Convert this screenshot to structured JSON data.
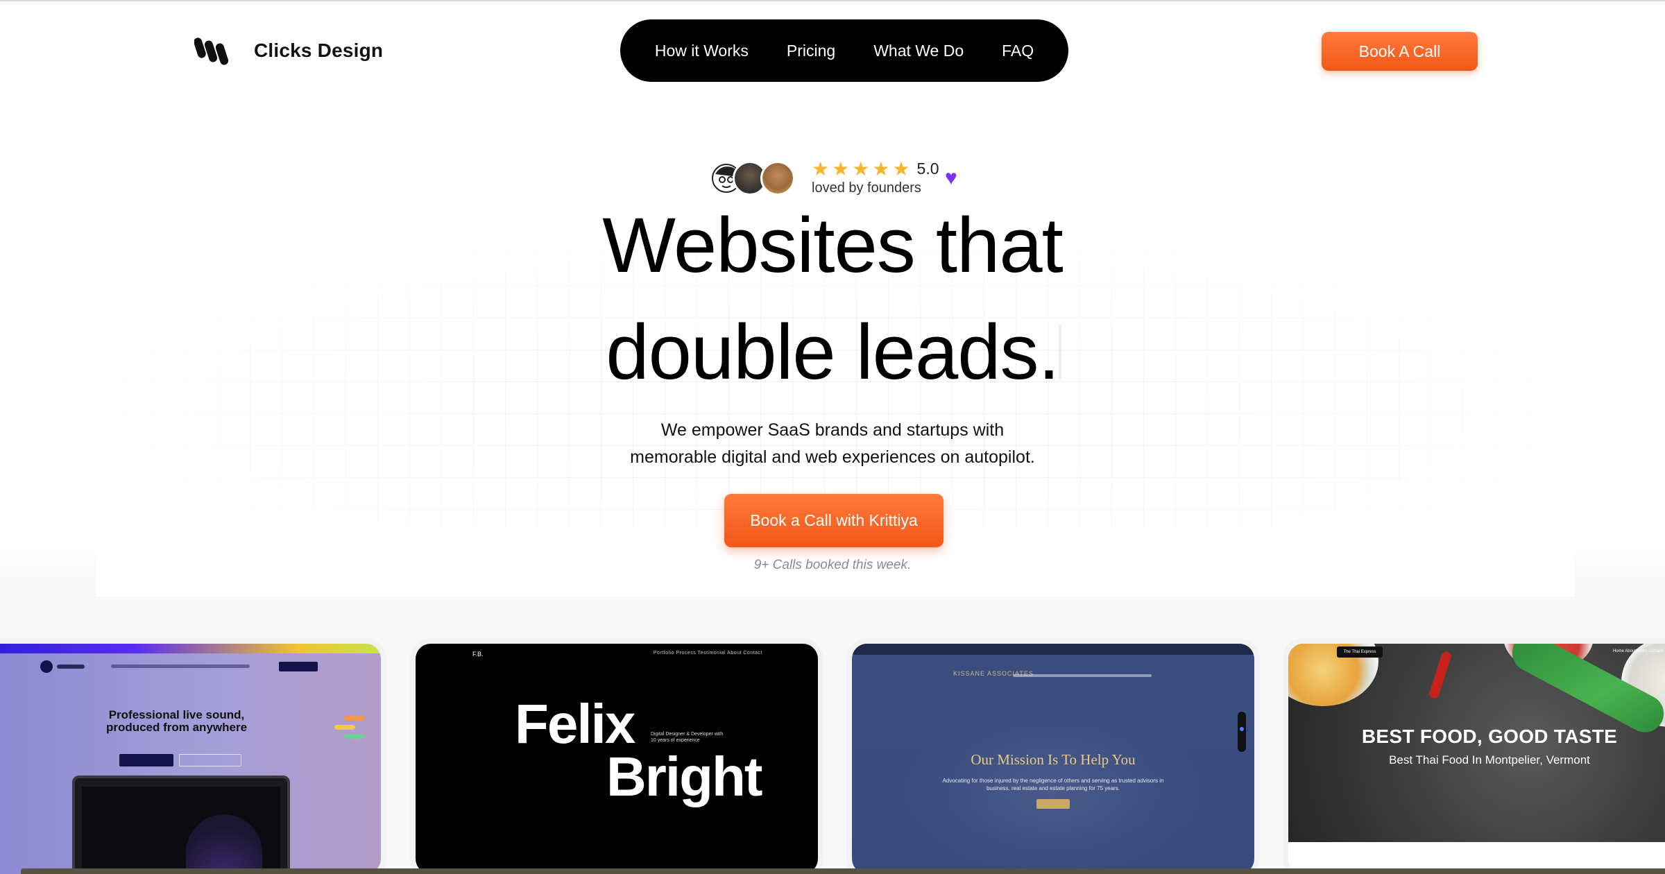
{
  "header": {
    "logo_text": "Clicks Design",
    "nav": [
      "How it Works",
      "Pricing",
      "What We Do",
      "FAQ"
    ],
    "cta": "Book A Call"
  },
  "hero": {
    "rating": "5.0",
    "stars": 5,
    "rating_caption": "loved by founders",
    "headline_line1": "Websites that",
    "headline_line2": "double leads.",
    "subtitle_line1": "We empower SaaS brands and startups with",
    "subtitle_line2": "memorable digital and web experiences on autopilot.",
    "cta": "Book a Call with Krittiya",
    "booked_note": "9+ Calls booked this week."
  },
  "portfolio": {
    "card1": {
      "title_line1": "Professional live sound,",
      "title_line2": "produced from anywhere"
    },
    "card2": {
      "mark": "F.B.",
      "nav": "Portfolio   Process   Testimonial   About   Contact",
      "name_line1": "Felix",
      "name_line2": "Bright",
      "tagline": "Digital Designer  & Developer with\n10 years of experience"
    },
    "card3": {
      "brand": "KISSANE ASSOCIATES",
      "heading": "Our Mission Is To Help You",
      "body": "Advocating for those injured by the negligence of others and serving as trusted advisors in\nbusiness, real estate and estate planning for 75 years."
    },
    "card4": {
      "logo": "The Thai Express",
      "nav": "Home   About   Menu   Contact",
      "title": "BEST FOOD, GOOD TASTE",
      "subtitle": "Best Thai Food In Montpelier, Vermont"
    }
  },
  "colors": {
    "accent": "#f25716",
    "nav_bg": "#000000",
    "heart": "#7b2ff7",
    "star": "#f6b52b"
  }
}
